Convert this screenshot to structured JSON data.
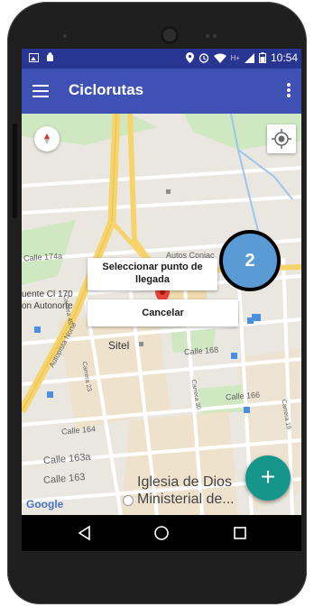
{
  "status_bar": {
    "time": "10:54",
    "signal_label": "H+",
    "bg_color": "#283593"
  },
  "app_bar": {
    "title": "Ciclorutas",
    "bg_color": "#3f51b5"
  },
  "map": {
    "labels": {
      "calle_174a": "Calle 174a",
      "autos": "Autos Coniac",
      "fuente": "uente Cl 170",
      "autonorte": "on Autonorte",
      "autopista": "Autopista Norte",
      "carrera45": "Carrera 45",
      "carrera23": "Carrera 23",
      "sitel": "Sitel",
      "calle168": "Calle 168",
      "carrera30": "Carrera 30",
      "calle166": "Calle 166",
      "carrera19": "Carrera 19",
      "calle164": "Calle 164",
      "calle163a": "Calle 163a",
      "calle163": "Calle 163",
      "iglesia1": "Iglesia de Dios",
      "iglesia2": "Ministerial de...",
      "google": "Google"
    }
  },
  "dialog": {
    "select_arrival_line1": "Seleccionar punto de",
    "select_arrival_line2": "llegada",
    "cancel_label": "Cancelar"
  },
  "step_badge": {
    "number": "2",
    "color": "#5b9bd5"
  },
  "fab": {
    "icon": "plus-icon",
    "symbol": "+",
    "color": "#16958a"
  },
  "nav": {
    "back": "back-triangle-icon",
    "home": "home-circle-icon",
    "recents": "recents-square-icon"
  }
}
